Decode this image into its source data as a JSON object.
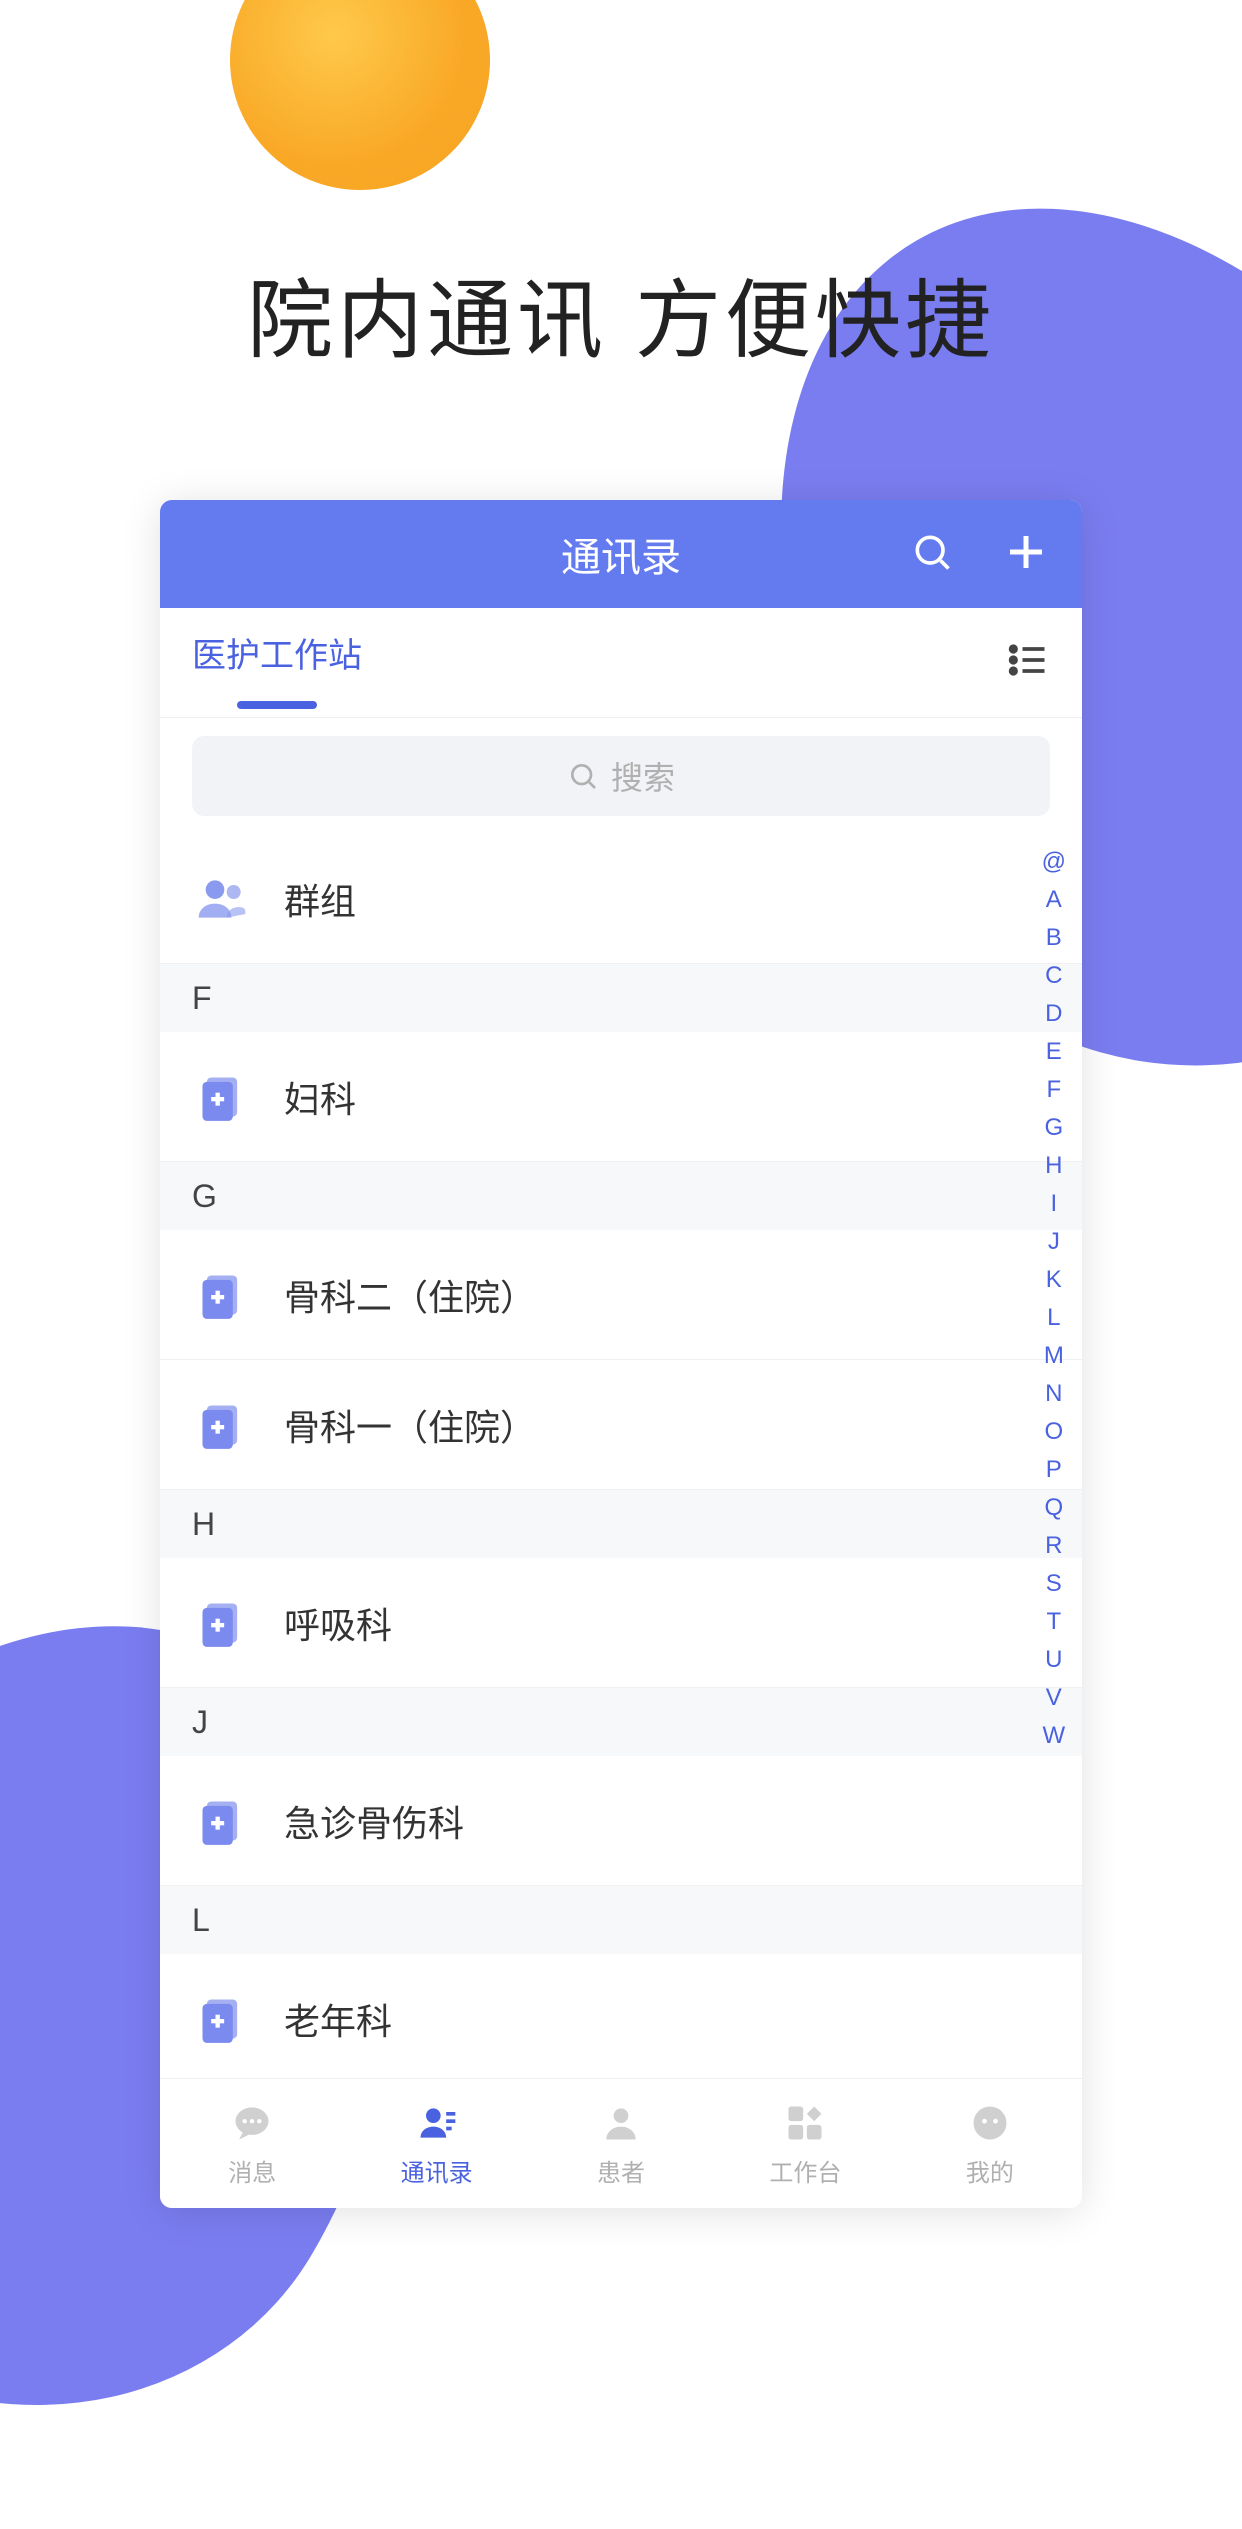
{
  "promo": {
    "title": "院内通讯  方便快捷"
  },
  "header": {
    "title": "通讯录"
  },
  "tab": {
    "active_label": "医护工作站"
  },
  "search": {
    "placeholder": "搜索"
  },
  "groups": {
    "label": "群组"
  },
  "sections": [
    {
      "letter": "F",
      "items": [
        {
          "label": "妇科"
        }
      ]
    },
    {
      "letter": "G",
      "items": [
        {
          "label": "骨科二（住院）"
        },
        {
          "label": "骨科一（住院）"
        }
      ]
    },
    {
      "letter": "H",
      "items": [
        {
          "label": "呼吸科"
        }
      ]
    },
    {
      "letter": "J",
      "items": [
        {
          "label": "急诊骨伤科"
        }
      ]
    },
    {
      "letter": "L",
      "items": [
        {
          "label": "老年科"
        }
      ]
    }
  ],
  "index_letters": [
    "@",
    "A",
    "B",
    "C",
    "D",
    "E",
    "F",
    "G",
    "H",
    "I",
    "J",
    "K",
    "L",
    "M",
    "N",
    "O",
    "P",
    "Q",
    "R",
    "S",
    "T",
    "U",
    "V",
    "W"
  ],
  "bottom_nav": {
    "items": [
      {
        "label": "消息",
        "icon": "chat"
      },
      {
        "label": "通讯录",
        "icon": "contacts",
        "active": true
      },
      {
        "label": "患者",
        "icon": "person"
      },
      {
        "label": "工作台",
        "icon": "grid"
      },
      {
        "label": "我的",
        "icon": "face"
      }
    ]
  }
}
